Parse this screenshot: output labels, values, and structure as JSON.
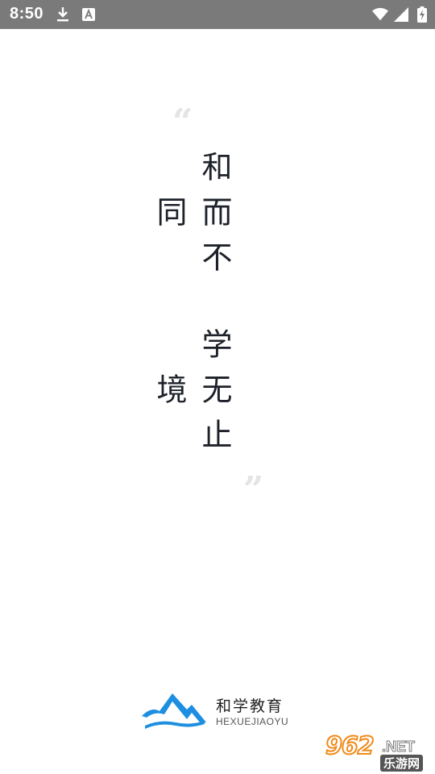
{
  "status_bar": {
    "time": "8:50",
    "left_icons": [
      "download-icon",
      "a-text-icon"
    ],
    "right_icons": [
      "wifi-icon",
      "signal-icon",
      "battery-charging-icon"
    ],
    "background": "#7a7a7a"
  },
  "splash": {
    "open_quote": "“",
    "close_quote": "”",
    "motto_line_1": "和而不同",
    "motto_line_2": "学无止境",
    "text_color": "#1d2129"
  },
  "logo": {
    "title": "和学教育",
    "subtitle": "HEXUEJIAOYU",
    "brand_color": "#1e8fe0"
  },
  "watermark": {
    "number": "962",
    "tld": ".NET",
    "site_name": "乐游网"
  }
}
